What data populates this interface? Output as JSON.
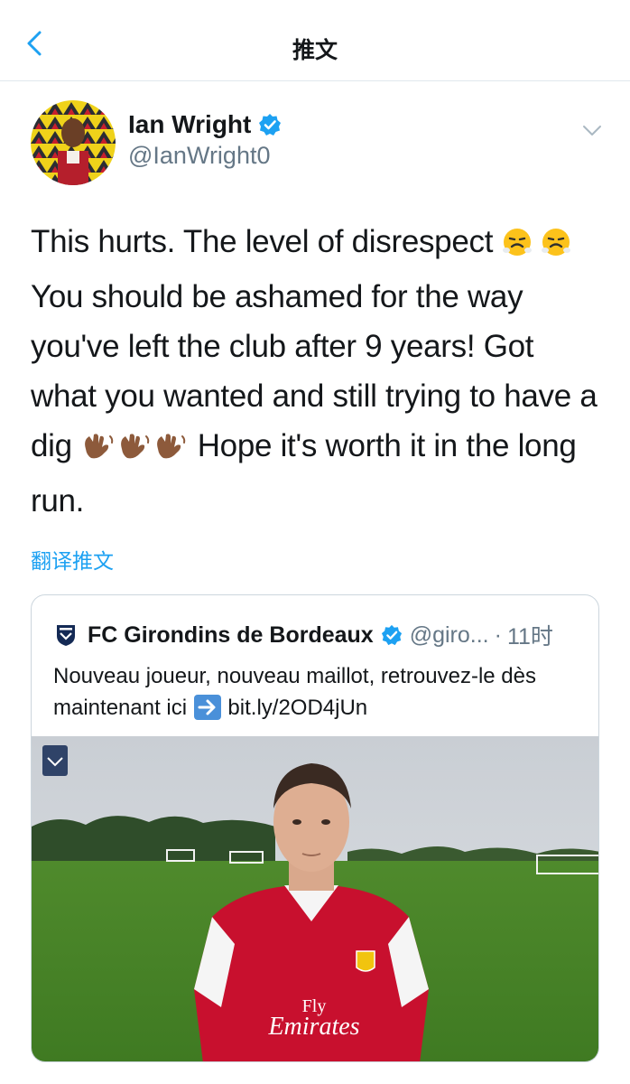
{
  "nav": {
    "title": "推文"
  },
  "author": {
    "name": "Ian Wright",
    "handle": "@IanWright0",
    "verified": true
  },
  "tweet": {
    "line1": "This hurts. The level of disrespect",
    "line2": "You should be ashamed for the way you've left the club after 9 years! Got what you wanted and still trying to have a dig",
    "line3": "Hope it's worth it in the long run.",
    "emoji_1": "steam-from-nose-face",
    "emoji_2": "waving-hand-dark-skin"
  },
  "translate": {
    "label": "翻译推文"
  },
  "quoted": {
    "name": "FC Girondins de Bordeaux",
    "handle": "@giro...",
    "separator": "·",
    "time": "11时",
    "text_part1": "Nouveau joueur, nouveau maillot, retrouvez-le dès maintenant ici",
    "text_part2": "bit.ly/2OD4jUn",
    "arrow_icon": "right-arrow-emoji",
    "media": {
      "shirt_sponsor_line1": "Fly",
      "shirt_sponsor_line2": "Emirates"
    }
  },
  "colors": {
    "accent": "#1da1f2",
    "text": "#14171a",
    "secondary": "#657786",
    "border": "#e1e8ed"
  }
}
